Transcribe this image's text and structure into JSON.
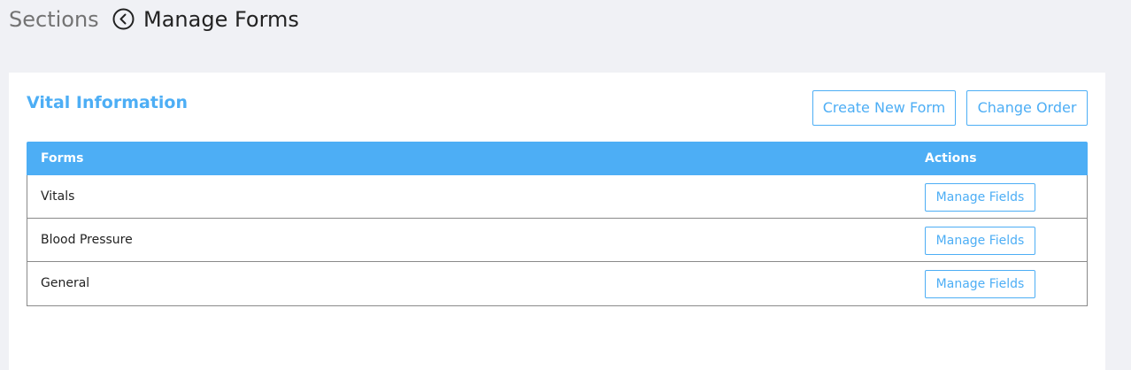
{
  "header": {
    "breadcrumb_root": "Sections",
    "back_icon": "chevron-left-circle-icon",
    "title": "Manage Forms"
  },
  "card": {
    "title": "Vital Information",
    "create_button": "Create New Form",
    "order_button": "Change Order"
  },
  "table": {
    "columns": [
      "Forms",
      "Actions"
    ],
    "rows": [
      {
        "name": "Vitals",
        "action": "Manage Fields"
      },
      {
        "name": "Blood Pressure",
        "action": "Manage Fields"
      },
      {
        "name": "General",
        "action": "Manage Fields"
      }
    ]
  },
  "colors": {
    "accent": "#4daef5",
    "page_bg": "#f0f1f5",
    "card_bg": "#ffffff",
    "row_border": "#8a8a8a"
  }
}
